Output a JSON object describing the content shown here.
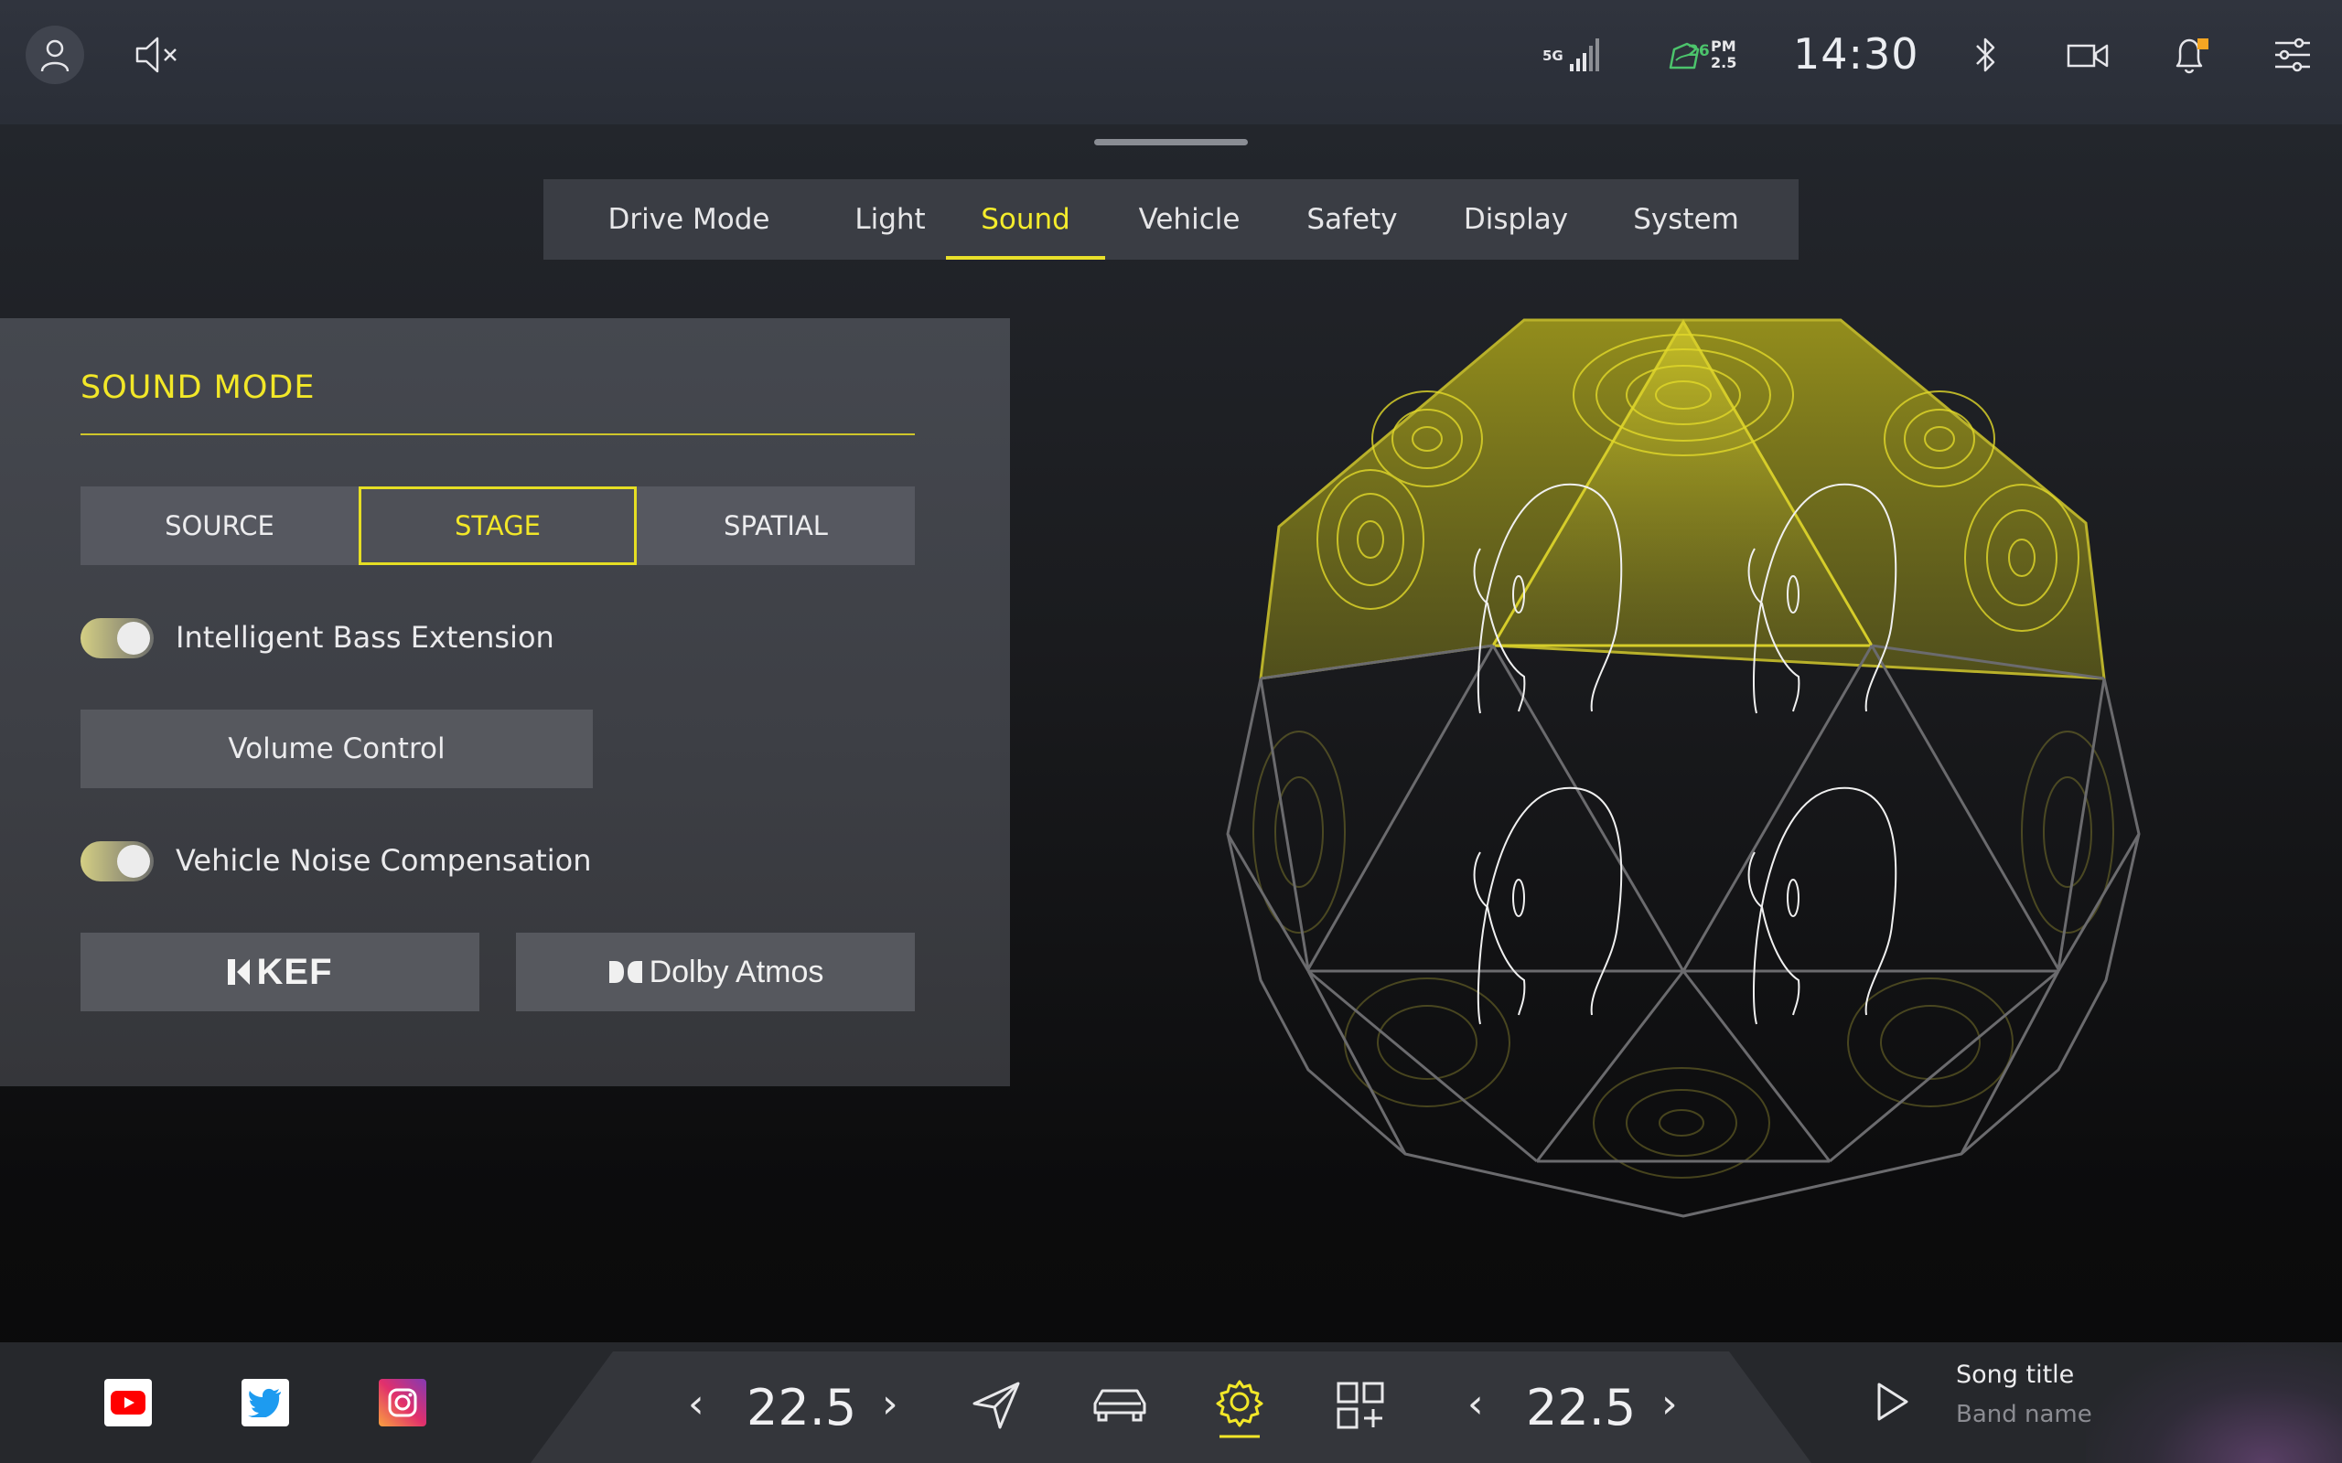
{
  "status_bar": {
    "network": "5G",
    "aqi_value": "26",
    "pm_label": "PM",
    "pm_value": "2.5",
    "time": "14:30",
    "icons": [
      "user-icon",
      "mute-icon",
      "signal-icon",
      "air-quality-icon",
      "bluetooth-icon",
      "camera-icon",
      "notification-bell-icon",
      "settings-sliders-icon"
    ],
    "colors": {
      "aqi_green": "#4cc46c",
      "notification_badge": "#f5a623"
    }
  },
  "tabs": [
    {
      "label": "Drive Mode",
      "active": false
    },
    {
      "label": "Light",
      "active": false
    },
    {
      "label": "Sound",
      "active": true
    },
    {
      "label": "Vehicle",
      "active": false
    },
    {
      "label": "Safety",
      "active": false
    },
    {
      "label": "Display",
      "active": false
    },
    {
      "label": "System",
      "active": false
    }
  ],
  "sound_panel": {
    "title": "SOUND MODE",
    "modes": [
      {
        "label": "SOURCE",
        "active": false
      },
      {
        "label": "STAGE",
        "active": true
      },
      {
        "label": "SPATIAL",
        "active": false
      }
    ],
    "toggle_bass": {
      "label": "Intelligent Bass Extension",
      "on": true
    },
    "volume_control_label": "Volume Control",
    "toggle_noise": {
      "label": "Vehicle Noise Compensation",
      "on": true
    },
    "brand_kef": "KEF",
    "brand_dolby": "Dolby Atmos"
  },
  "dock": {
    "apps": [
      "youtube-icon",
      "twitter-icon",
      "instagram-icon"
    ],
    "left_temp": "22.5",
    "right_temp": "22.5",
    "nav_icons": [
      "navigation-icon",
      "car-icon",
      "settings-gear-icon",
      "apps-add-icon"
    ],
    "active_nav": "settings-gear-icon",
    "song_title": "Song title",
    "band_name": "Band name"
  },
  "accent_color": "#f2e728"
}
